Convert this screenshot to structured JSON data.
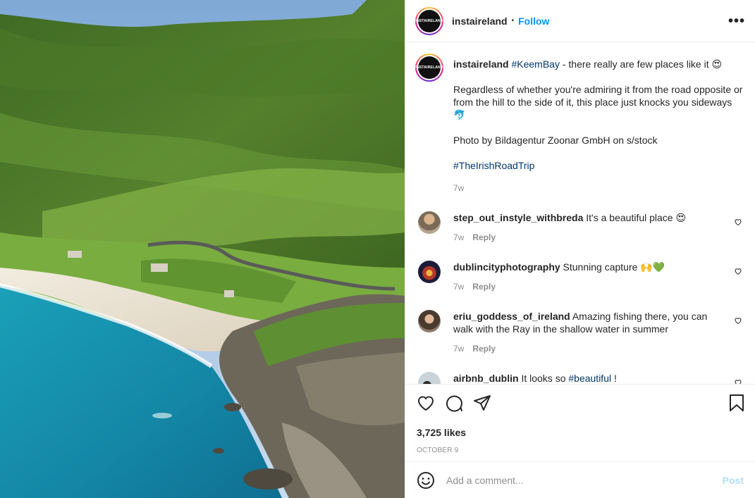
{
  "header": {
    "username": "instaireland",
    "separator": "•",
    "follow_label": "Follow",
    "more_label": "•••",
    "avatar_text": "INSTAIRELAND"
  },
  "caption": {
    "username": "instaireland",
    "hashtag": "#KeemBay",
    "line1": " - there really are few places like it 😍",
    "para2": "Regardless of whether you're admiring it from the road opposite or from the hill to the side of it, this place just knocks you sideways 🐬",
    "para3": "Photo by Bildagentur Zoonar GmbH on s/stock",
    "hashtag2": "#TheIrishRoadTrip",
    "time": "7w"
  },
  "comments": [
    {
      "username": "step_out_instyle_withbreda",
      "text": " It's a beautiful place 😍",
      "time": "7w",
      "reply": "Reply"
    },
    {
      "username": "dublincityphotography",
      "text": " Stunning capture 🙌💚",
      "time": "7w",
      "reply": "Reply"
    },
    {
      "username": "eriu_goddess_of_ireland",
      "text": " Amazing fishing there, you can walk with the Ray in the shallow water in summer",
      "time": "7w",
      "reply": "Reply"
    },
    {
      "username": "airbnb_dublin",
      "text": " It looks so ",
      "hashtag": "#beautiful",
      "tail": " !"
    }
  ],
  "likes": "3,725 likes",
  "date": "OCTOBER 9",
  "add_comment": {
    "placeholder": "Add a comment...",
    "post_label": "Post"
  },
  "icons": [
    "like-icon",
    "comment-icon",
    "share-icon",
    "save-icon",
    "emoji-icon",
    "small-heart-icon"
  ],
  "colors": {
    "link": "#0095f6",
    "hashtag": "#00376b",
    "muted": "#8e8e8e",
    "post_disabled": "#b2dffc"
  }
}
